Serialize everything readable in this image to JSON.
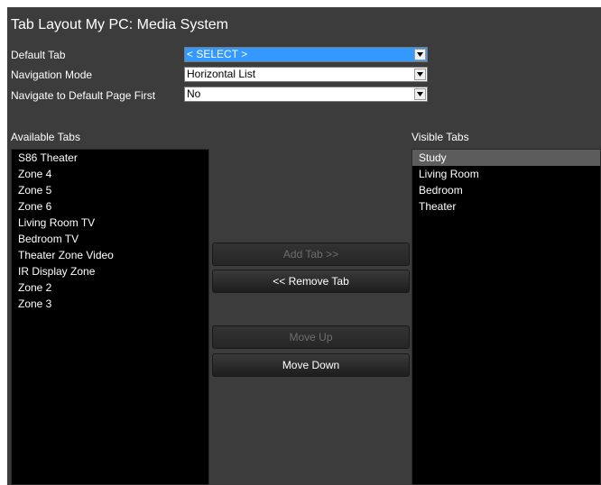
{
  "title": "Tab Layout My PC: Media System",
  "fields": [
    {
      "label": "Default Tab",
      "value": "< SELECT >"
    },
    {
      "label": "Navigation Mode",
      "value": "Horizontal List"
    },
    {
      "label": "Navigate to Default Page First",
      "value": "No"
    }
  ],
  "available": {
    "label": "Available Tabs",
    "items": [
      "S86 Theater",
      "Zone 4",
      "Zone 5",
      "Zone 6",
      "Living Room TV",
      "Bedroom TV",
      "Theater Zone Video",
      "IR Display Zone",
      "Zone 2",
      "Zone 3"
    ]
  },
  "visible": {
    "label": "Visible Tabs",
    "items": [
      "Study",
      "Living Room",
      "Bedroom",
      "Theater"
    ],
    "selected_item": "Study"
  },
  "buttons": {
    "add_tab": "Add Tab >>",
    "remove_tab": "<< Remove Tab",
    "move_up": "Move Up",
    "move_down": "Move Down"
  },
  "colors": {
    "panel_bg": "#3c3c3c",
    "list_bg": "#000000",
    "selection_highlight": "#3399ff",
    "list_selected_row": "#5c5c5c"
  }
}
